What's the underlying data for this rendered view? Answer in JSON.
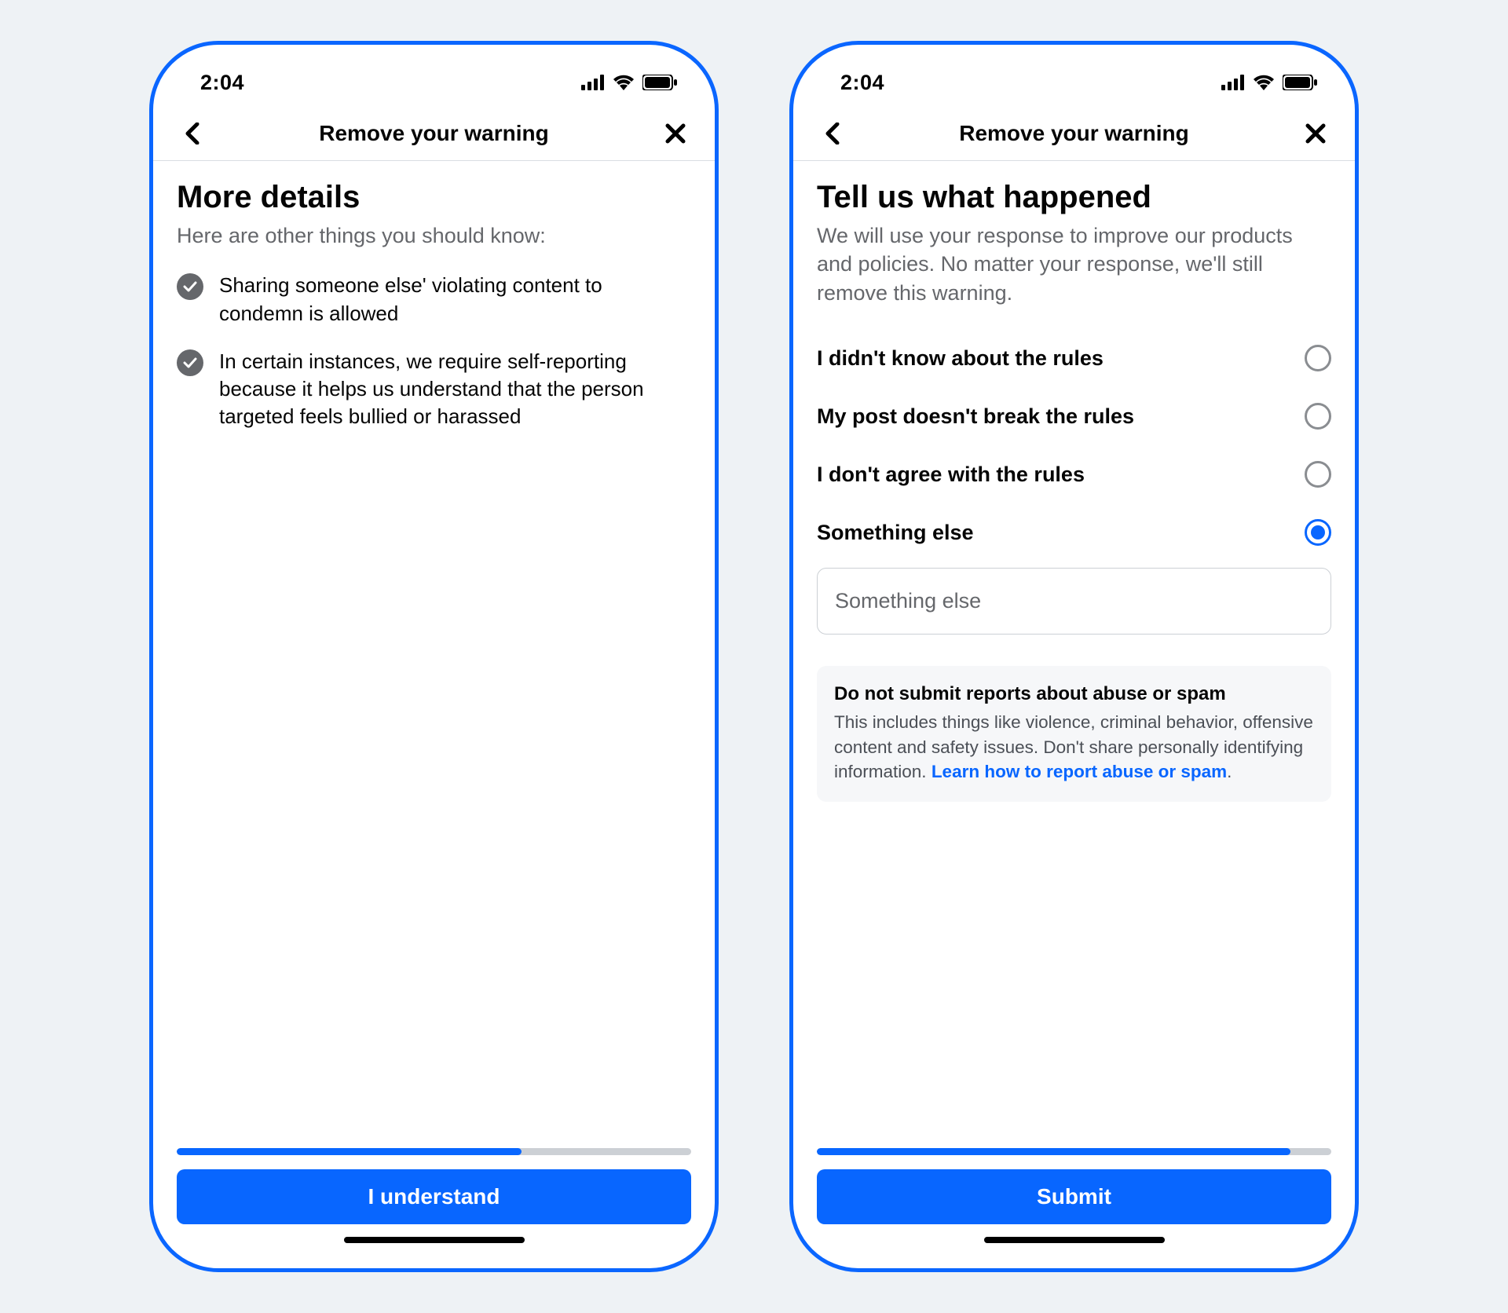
{
  "status": {
    "time": "2:04"
  },
  "colors": {
    "accent": "#0866ff",
    "gray": "#65676b"
  },
  "screens": {
    "left": {
      "nav_title": "Remove your warning",
      "title": "More details",
      "subtitle": "Here are other things you should know:",
      "bullets": [
        "Sharing someone else' violating content to condemn is allowed",
        "In certain instances, we require self-reporting because it helps us understand that the person targeted feels bullied or harassed"
      ],
      "progress_pct": 67,
      "button": "I understand"
    },
    "right": {
      "nav_title": "Remove your warning",
      "title": "Tell us what happened",
      "subtitle": "We will use your response to improve our products and policies. No matter your response, we'll still remove this warning.",
      "options": [
        {
          "label": "I didn't know about the rules",
          "selected": false
        },
        {
          "label": "My post doesn't break the rules",
          "selected": false
        },
        {
          "label": "I don't agree with the rules",
          "selected": false
        },
        {
          "label": "Something else",
          "selected": true
        }
      ],
      "input_placeholder": "Something else",
      "notice": {
        "title": "Do not submit reports about abuse or spam",
        "body": "This includes things like violence, criminal behavior, offensive content and safety issues. Don't share personally identifying information. ",
        "link": "Learn how to report abuse or spam",
        "period": "."
      },
      "progress_pct": 92,
      "button": "Submit"
    }
  }
}
